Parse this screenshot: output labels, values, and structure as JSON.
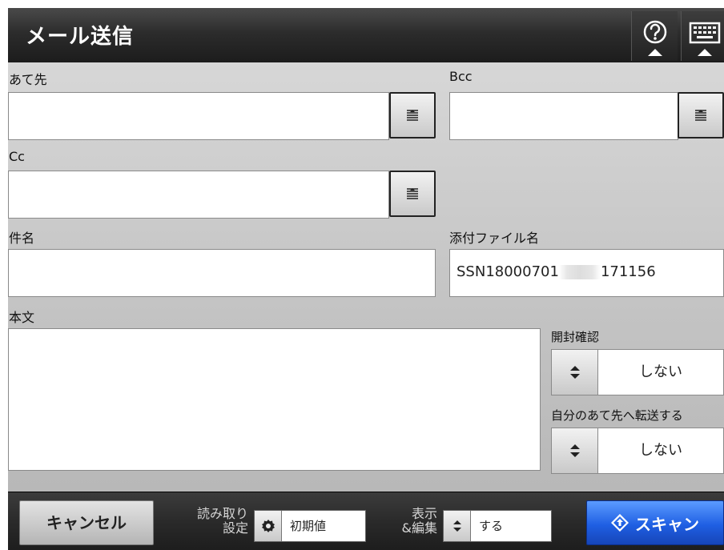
{
  "header": {
    "title": "メール送信"
  },
  "form": {
    "to": {
      "label": "あて先",
      "value": ""
    },
    "bcc": {
      "label": "Bcc",
      "value": ""
    },
    "cc": {
      "label": "Cc",
      "value": ""
    },
    "subject": {
      "label": "件名",
      "value": ""
    },
    "attachment": {
      "label": "添付ファイル名",
      "value_prefix": "SSN18000701",
      "value_suffix": "171156"
    },
    "body": {
      "label": "本文",
      "value": ""
    },
    "read_receipt": {
      "label": "開封確認",
      "value": "しない"
    },
    "forward_self": {
      "label": "自分のあて先へ転送する",
      "value": "しない"
    }
  },
  "footer": {
    "cancel_label": "キャンセル",
    "scan_settings": {
      "label_line1": "読み取り",
      "label_line2": "設定",
      "value": "初期値"
    },
    "display_edit": {
      "label_line1": "表示",
      "label_line2": "&編集",
      "value": "する"
    },
    "scan_label": "スキャン"
  },
  "icons": [
    "help-icon",
    "keyboard-icon",
    "address-book-icon",
    "updown-arrow-icon",
    "gear-icon",
    "scan-diamond-icon"
  ],
  "colors": {
    "header_bg": "#2c2c2c",
    "body_bg": "#c9c9c9",
    "scan_button": "#1f5fe3"
  }
}
